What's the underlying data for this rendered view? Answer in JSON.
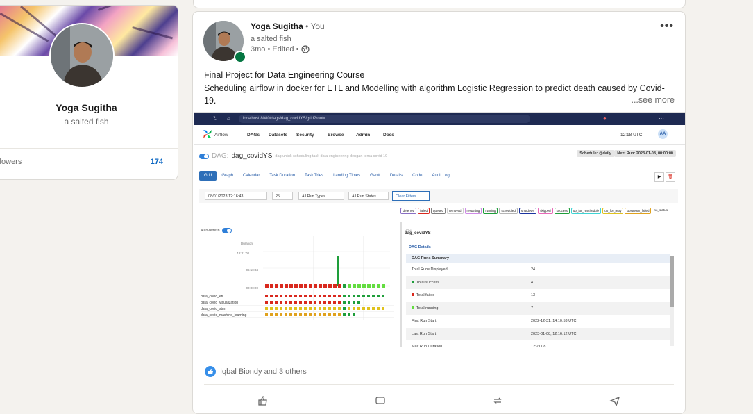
{
  "profile": {
    "name": "Yoga Sugitha",
    "tagline": "a salted fish",
    "followers_label": "ollowers",
    "followers_count": "174"
  },
  "post": {
    "author": "Yoga Sugitha",
    "relation": "• You",
    "subtitle": "a salted fish",
    "meta": "3mo • Edited •",
    "more_label": "•••",
    "text_line1": "Final Project for Data Engineering Course",
    "text_line2": "Scheduling airflow in docker for ETL and Modelling with algorithm Logistic Regression to predict death caused by Covid-19.",
    "see_more": "...see more",
    "reactions": "Iqbal Biondy and 3 others"
  },
  "screenshot": {
    "url": "localhost:8080/dags/dag_covidYS/grid?root=",
    "nav": [
      "DAGs",
      "Datasets",
      "Security",
      "Browse",
      "Admin",
      "Docs"
    ],
    "logo_text": "Airflow",
    "time": "12:18 UTC",
    "user_initials": "AA",
    "dag_prefix": "DAG:",
    "dag_name": "dag_covidYS",
    "dag_desc": "dag untuk scheduling task data engineering dengan tema covid 19",
    "schedule": "Schedule: @daily",
    "next_run": "Next Run: 2023-01-08, 00:00:00",
    "tabs": [
      "Grid",
      "Graph",
      "Calendar",
      "Task Duration",
      "Task Tries",
      "Landing Times",
      "Gantt",
      "Details",
      "Code",
      "Audit Log"
    ],
    "filter_date": "08/01/2023 12:16:43",
    "filter_count": "25",
    "filter_run_types": "All Run Types",
    "filter_run_states": "All Run States",
    "clear_filters": "Clear Filters",
    "states": [
      "deferred",
      "failed",
      "queued",
      "removed",
      "restarting",
      "running",
      "scheduled",
      "shutdown",
      "skipped",
      "success",
      "up_for_reschedule",
      "up_for_retry",
      "upstream_failed",
      "no_status"
    ],
    "auto_refresh": "Auto-refresh",
    "tasks": [
      "data_covid_etl",
      "data_covid_visualization",
      "data_covid_strm",
      "data_covid_machine_learning"
    ],
    "duration_labels": [
      "Duration",
      "12:21:08",
      "06:10:34",
      "00:00:00"
    ],
    "details_dag_label": "DAG",
    "details_dag_name": "dag_covidYS",
    "details_header": "DAG Details",
    "details_rows": [
      {
        "k": "DAG Runs Summary",
        "v": ""
      },
      {
        "k": "Total Runs Displayed",
        "v": "24"
      },
      {
        "k": "Total success",
        "v": "4"
      },
      {
        "k": "Total failed",
        "v": "13"
      },
      {
        "k": "Total running",
        "v": "7"
      },
      {
        "k": "First Run Start",
        "v": "2022-12-31, 14:10:53 UTC"
      },
      {
        "k": "Last Run Start",
        "v": "2023-01-08, 12:16:12 UTC"
      },
      {
        "k": "Max Run Duration",
        "v": "12:21:08"
      }
    ]
  },
  "colors": {
    "linkedin_blue": "#0a66c2",
    "online": "#057642",
    "success": "#1e9e3a",
    "failed": "#d9281d",
    "running": "#63dd3f",
    "queued": "#e0c21d"
  }
}
